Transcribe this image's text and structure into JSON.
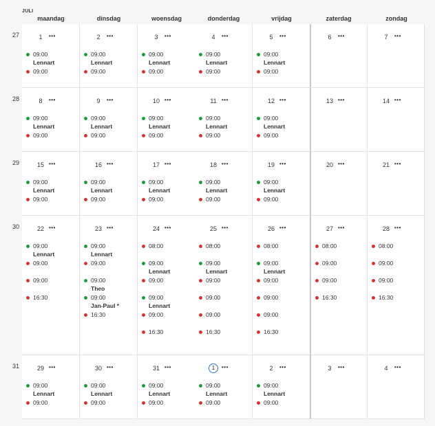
{
  "month_label": "JULI",
  "day_headers": [
    "maandag",
    "dinsdag",
    "woensdag",
    "donderdag",
    "vrijdag",
    "zaterdag",
    "zondag"
  ],
  "more_label": "•••",
  "colors": {
    "green": "#1c9b3d",
    "red": "#d23535",
    "today": "#2b78c8"
  },
  "weeks": [
    {
      "number": "27",
      "days": [
        {
          "day": "1",
          "events": [
            {
              "time": "09:00",
              "color": "green",
              "person": "Lennart"
            },
            {
              "time": "09:00",
              "color": "red"
            }
          ]
        },
        {
          "day": "2",
          "events": [
            {
              "time": "09:00",
              "color": "green",
              "person": "Lennart"
            },
            {
              "time": "09:00",
              "color": "red"
            }
          ]
        },
        {
          "day": "3",
          "events": [
            {
              "time": "09:00",
              "color": "green",
              "person": "Lennart"
            },
            {
              "time": "09:00",
              "color": "red"
            }
          ]
        },
        {
          "day": "4",
          "events": [
            {
              "time": "09:00",
              "color": "green",
              "person": "Lennart"
            },
            {
              "time": "09:00",
              "color": "red"
            }
          ]
        },
        {
          "day": "5",
          "events": [
            {
              "time": "09:00",
              "color": "green",
              "person": "Lennart"
            },
            {
              "time": "09:00",
              "color": "red"
            }
          ]
        },
        {
          "day": "6",
          "events": []
        },
        {
          "day": "7",
          "events": []
        }
      ]
    },
    {
      "number": "28",
      "days": [
        {
          "day": "8",
          "events": [
            {
              "time": "09:00",
              "color": "green",
              "person": "Lennart"
            },
            {
              "time": "09:00",
              "color": "red"
            }
          ]
        },
        {
          "day": "9",
          "events": [
            {
              "time": "09:00",
              "color": "green",
              "person": "Lennart"
            },
            {
              "time": "09:00",
              "color": "red"
            }
          ]
        },
        {
          "day": "10",
          "events": [
            {
              "time": "09:00",
              "color": "green",
              "person": "Lennart"
            },
            {
              "time": "09:00",
              "color": "red"
            }
          ]
        },
        {
          "day": "11",
          "events": [
            {
              "time": "09:00",
              "color": "green",
              "person": "Lennart"
            },
            {
              "time": "09:00",
              "color": "red"
            }
          ]
        },
        {
          "day": "12",
          "events": [
            {
              "time": "09:00",
              "color": "green",
              "person": "Lennart"
            },
            {
              "time": "09:00",
              "color": "red"
            }
          ]
        },
        {
          "day": "13",
          "events": []
        },
        {
          "day": "14",
          "events": []
        }
      ]
    },
    {
      "number": "29",
      "days": [
        {
          "day": "15",
          "events": [
            {
              "time": "09:00",
              "color": "green",
              "person": "Lennart"
            },
            {
              "time": "09:00",
              "color": "red"
            }
          ]
        },
        {
          "day": "16",
          "events": [
            {
              "time": "09:00",
              "color": "green",
              "person": "Lennart"
            },
            {
              "time": "09:00",
              "color": "red"
            }
          ]
        },
        {
          "day": "17",
          "events": [
            {
              "time": "09:00",
              "color": "green",
              "person": "Lennart"
            },
            {
              "time": "09:00",
              "color": "red"
            }
          ]
        },
        {
          "day": "18",
          "events": [
            {
              "time": "09:00",
              "color": "green",
              "person": "Lennart"
            },
            {
              "time": "09:00",
              "color": "red"
            }
          ]
        },
        {
          "day": "19",
          "events": [
            {
              "time": "09:00",
              "color": "green",
              "person": "Lennart"
            },
            {
              "time": "09:00",
              "color": "red"
            }
          ]
        },
        {
          "day": "20",
          "events": []
        },
        {
          "day": "21",
          "events": []
        }
      ]
    },
    {
      "number": "30",
      "days": [
        {
          "day": "22",
          "events": [
            {
              "time": "09:00",
              "color": "green",
              "person": "Lennart"
            },
            {
              "time": "09:00",
              "color": "red"
            },
            {
              "time": "09:00",
              "color": "red"
            },
            {
              "time": "16:30",
              "color": "red"
            }
          ]
        },
        {
          "day": "23",
          "events": [
            {
              "time": "09:00",
              "color": "green",
              "person": "Lennart"
            },
            {
              "time": "09:00",
              "color": "red"
            },
            {
              "time": "09:00",
              "color": "green",
              "person": "Theo"
            },
            {
              "time": "09:00",
              "color": "green",
              "person": "Jan-Paul *"
            },
            {
              "time": "16:30",
              "color": "red"
            }
          ]
        },
        {
          "day": "24",
          "events": [
            {
              "time": "08:00",
              "color": "red"
            },
            {
              "time": "09:00",
              "color": "green",
              "person": "Lennart"
            },
            {
              "time": "09:00",
              "color": "red"
            },
            {
              "time": "09:00",
              "color": "green",
              "person": "Lennart"
            },
            {
              "time": "09:00",
              "color": "red"
            },
            {
              "time": "16:30",
              "color": "red"
            }
          ]
        },
        {
          "day": "25",
          "events": [
            {
              "time": "08:00",
              "color": "red"
            },
            {
              "time": "09:00",
              "color": "green",
              "person": "Lennart"
            },
            {
              "time": "09:00",
              "color": "red"
            },
            {
              "time": "09:00",
              "color": "red"
            },
            {
              "time": "09:00",
              "color": "red"
            },
            {
              "time": "16:30",
              "color": "red"
            }
          ]
        },
        {
          "day": "26",
          "events": [
            {
              "time": "08:00",
              "color": "red"
            },
            {
              "time": "09:00",
              "color": "green",
              "person": "Lennart"
            },
            {
              "time": "09:00",
              "color": "red"
            },
            {
              "time": "09:00",
              "color": "red"
            },
            {
              "time": "09:00",
              "color": "red"
            },
            {
              "time": "16:30",
              "color": "red"
            }
          ]
        },
        {
          "day": "27",
          "events": [
            {
              "time": "08:00",
              "color": "red"
            },
            {
              "time": "09:00",
              "color": "red"
            },
            {
              "time": "09:00",
              "color": "red"
            },
            {
              "time": "16:30",
              "color": "red"
            }
          ]
        },
        {
          "day": "28",
          "events": [
            {
              "time": "08:00",
              "color": "red"
            },
            {
              "time": "09:00",
              "color": "red"
            },
            {
              "time": "09:00",
              "color": "red"
            },
            {
              "time": "16:30",
              "color": "red"
            }
          ]
        }
      ]
    },
    {
      "number": "31",
      "days": [
        {
          "day": "29",
          "events": [
            {
              "time": "09:00",
              "color": "green",
              "person": "Lennart"
            },
            {
              "time": "09:00",
              "color": "red"
            }
          ]
        },
        {
          "day": "30",
          "events": [
            {
              "time": "09:00",
              "color": "green",
              "person": "Lennart"
            },
            {
              "time": "09:00",
              "color": "red"
            }
          ]
        },
        {
          "day": "31",
          "events": [
            {
              "time": "09:00",
              "color": "green",
              "person": "Lennart"
            },
            {
              "time": "09:00",
              "color": "red"
            }
          ]
        },
        {
          "day": "1",
          "today": true,
          "events": [
            {
              "time": "09:00",
              "color": "green",
              "person": "Lennart"
            },
            {
              "time": "09:00",
              "color": "red"
            }
          ]
        },
        {
          "day": "2",
          "events": [
            {
              "time": "09:00",
              "color": "green",
              "person": "Lennart"
            },
            {
              "time": "09:00",
              "color": "red"
            }
          ]
        },
        {
          "day": "3",
          "events": []
        },
        {
          "day": "4",
          "events": []
        }
      ]
    }
  ]
}
